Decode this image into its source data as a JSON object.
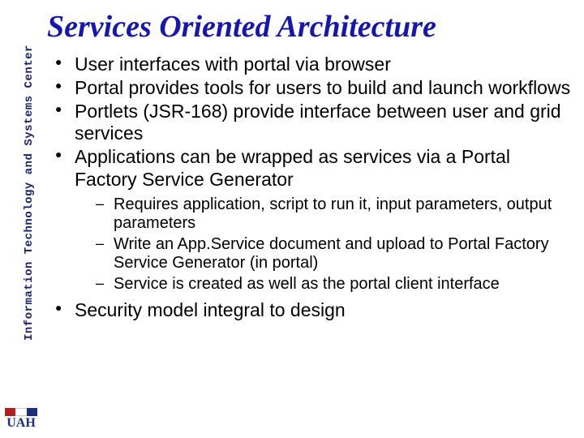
{
  "sidebar": {
    "label": "Information Technology and Systems Center",
    "logo_text": "UAH"
  },
  "title": "Services Oriented Architecture",
  "bullets": {
    "b1": "User interfaces with portal via browser",
    "b2": "Portal provides tools for users to build and launch workflows",
    "b3": "Portlets (JSR-168) provide interface between user and grid services",
    "b4": "Applications can be wrapped as services via a Portal Factory Service Generator",
    "b4_sub": {
      "s1": "Requires application, script to run it, input parameters, output parameters",
      "s2": "Write an App.Service document and upload to Portal Factory Service Generator (in portal)",
      "s3": "Service is created as well as the portal client interface"
    },
    "b5": "Security model integral to design"
  }
}
